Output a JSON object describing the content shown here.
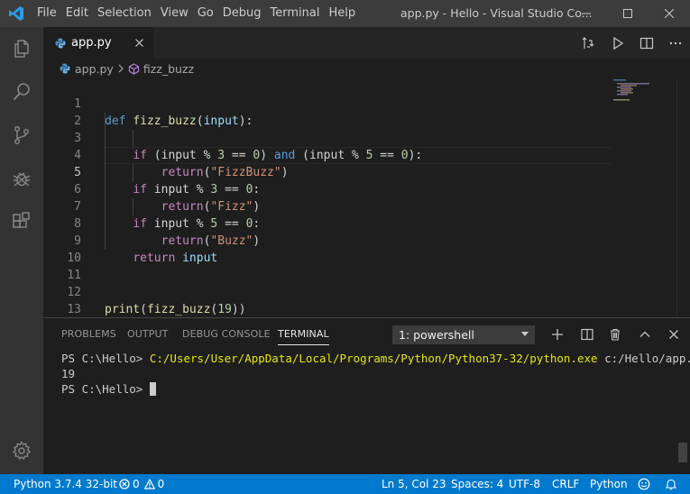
{
  "titlebar": {
    "menu": [
      "File",
      "Edit",
      "Selection",
      "View",
      "Go",
      "Debug",
      "Terminal",
      "Help"
    ],
    "window_title": "app.py - Hello - Visual Studio Co..."
  },
  "tab": {
    "label": "app.py"
  },
  "breadcrumb": {
    "file": "app.py",
    "symbol": "fizz_buzz"
  },
  "editor": {
    "line_numbers": [
      "1",
      "2",
      "3",
      "4",
      "5",
      "6",
      "7",
      "8",
      "9",
      "10",
      "11",
      "12",
      "13"
    ],
    "active_line": 5,
    "lines": {
      "l1": [
        "def",
        "fizz_buzz",
        "(",
        "input",
        "):"
      ],
      "l3": [
        "if",
        "(input % ",
        "3",
        " == ",
        "0",
        ") ",
        "and",
        " (input % ",
        "5",
        " == ",
        "0",
        "):"
      ],
      "l4": [
        "return",
        "(",
        "\"FizzBuzz\"",
        ")"
      ],
      "l5": [
        "if",
        " input % ",
        "3",
        " == ",
        "0",
        ":"
      ],
      "l6": [
        "return",
        "(",
        "\"Fizz\"",
        ")"
      ],
      "l7": [
        "if",
        " input % ",
        "5",
        " == ",
        "0",
        ":"
      ],
      "l8": [
        "return",
        "(",
        "\"Buzz\"",
        ")"
      ],
      "l9": [
        "return",
        " input"
      ],
      "l12": [
        "print",
        "(",
        "fizz_buzz",
        "(",
        "19",
        "))"
      ]
    }
  },
  "panel": {
    "tabs": [
      "PROBLEMS",
      "OUTPUT",
      "DEBUG CONSOLE",
      "TERMINAL"
    ],
    "active_tab": "TERMINAL",
    "terminal_select": "1: powershell",
    "terminal": {
      "line1_prompt": "PS C:\\Hello> ",
      "line1_cmd": "C:/Users/User/AppData/Local/Programs/Python/Python37-32/python.exe",
      "line1_arg": " c:/Hello/app.py",
      "line2": "19",
      "line3_prompt": "PS C:\\Hello> "
    }
  },
  "statusbar": {
    "interpreter": "Python 3.7.4 32-bit",
    "errors": "0",
    "warnings": "0",
    "position": "Ln 5, Col 23",
    "spaces": "Spaces: 4",
    "encoding": "UTF-8",
    "eol": "CRLF",
    "language": "Python"
  },
  "colors": {
    "accent": "#007acc",
    "keyword": "#569cd6",
    "control": "#c586c0",
    "function": "#dcdcaa",
    "string": "#ce9178",
    "number": "#b5cea8",
    "terminal_path": "#e5e510"
  },
  "icons": {
    "activity": [
      "explorer-icon",
      "search-icon",
      "source-control-icon",
      "debug-icon",
      "extensions-icon",
      "settings-gear-icon"
    ],
    "editor_actions": [
      "open-changes-icon",
      "run-icon",
      "split-editor-icon",
      "more-actions-icon"
    ]
  }
}
